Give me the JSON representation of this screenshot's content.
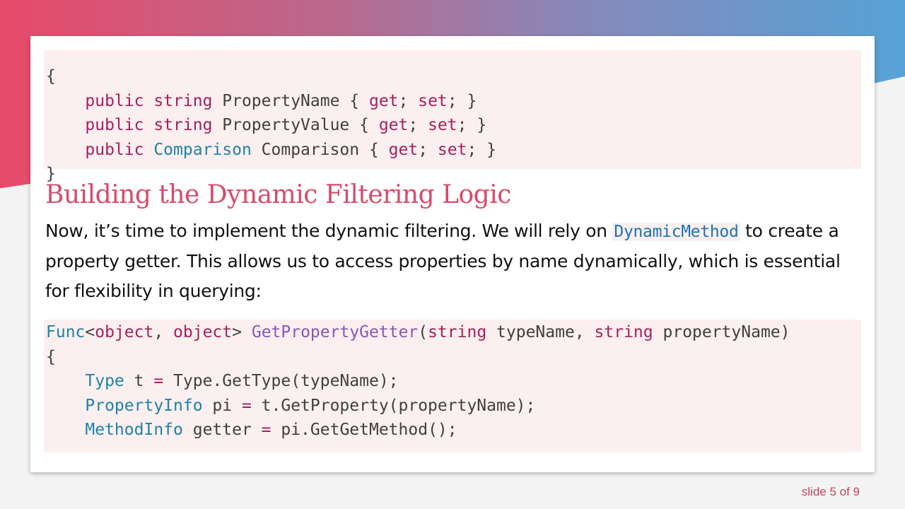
{
  "colors": {
    "accent": "#d9496c",
    "keyword": "#a3215e",
    "type": "#1d84a8",
    "function": "#8757b8",
    "code_bg": "#fcefef"
  },
  "code_block_1": {
    "lines": [
      [
        {
          "t": "{",
          "c": "p"
        }
      ],
      [
        {
          "t": "    public ",
          "c": "kw"
        },
        {
          "t": "string ",
          "c": "kw"
        },
        {
          "t": "PropertyName { ",
          "c": "p"
        },
        {
          "t": "get",
          "c": "kw"
        },
        {
          "t": "; ",
          "c": "p"
        },
        {
          "t": "set",
          "c": "kw"
        },
        {
          "t": "; }",
          "c": "p"
        }
      ],
      [
        {
          "t": "    public ",
          "c": "kw"
        },
        {
          "t": "string ",
          "c": "kw"
        },
        {
          "t": "PropertyValue { ",
          "c": "p"
        },
        {
          "t": "get",
          "c": "kw"
        },
        {
          "t": "; ",
          "c": "p"
        },
        {
          "t": "set",
          "c": "kw"
        },
        {
          "t": "; }",
          "c": "p"
        }
      ],
      [
        {
          "t": "    public ",
          "c": "kw"
        },
        {
          "t": "Comparison ",
          "c": "type"
        },
        {
          "t": "Comparison { ",
          "c": "p"
        },
        {
          "t": "get",
          "c": "kw"
        },
        {
          "t": "; ",
          "c": "p"
        },
        {
          "t": "set",
          "c": "kw"
        },
        {
          "t": "; }",
          "c": "p"
        }
      ],
      [
        {
          "t": "}",
          "c": "p"
        }
      ]
    ]
  },
  "heading": "Building the Dynamic Filtering Logic",
  "paragraph": {
    "before": "Now, it’s time to implement the dynamic filtering. We will rely on ",
    "inline_code": "DynamicMethod",
    "after": " to create a property getter. This allows us to access properties by name dynamically, which is essential for flexibility in querying:"
  },
  "code_block_2": {
    "lines": [
      [
        {
          "t": "Func",
          "c": "type"
        },
        {
          "t": "<",
          "c": "p"
        },
        {
          "t": "object",
          "c": "kw"
        },
        {
          "t": ", ",
          "c": "p"
        },
        {
          "t": "object",
          "c": "kw"
        },
        {
          "t": "> ",
          "c": "p"
        },
        {
          "t": "GetPropertyGetter",
          "c": "fn"
        },
        {
          "t": "(",
          "c": "p"
        },
        {
          "t": "string ",
          "c": "kw"
        },
        {
          "t": "typeName, ",
          "c": "p"
        },
        {
          "t": "string ",
          "c": "kw"
        },
        {
          "t": "propertyName)",
          "c": "p"
        }
      ],
      [
        {
          "t": "{",
          "c": "p"
        }
      ],
      [
        {
          "t": "    Type ",
          "c": "type"
        },
        {
          "t": "t ",
          "c": "p"
        },
        {
          "t": "= ",
          "c": "kw"
        },
        {
          "t": "Type.GetType(typeName);",
          "c": "p"
        }
      ],
      [
        {
          "t": "    PropertyInfo ",
          "c": "type"
        },
        {
          "t": "pi ",
          "c": "p"
        },
        {
          "t": "= ",
          "c": "kw"
        },
        {
          "t": "t.GetProperty(propertyName);",
          "c": "p"
        }
      ],
      [
        {
          "t": "    MethodInfo ",
          "c": "type"
        },
        {
          "t": "getter ",
          "c": "p"
        },
        {
          "t": "= ",
          "c": "kw"
        },
        {
          "t": "pi.GetGetMethod();",
          "c": "p"
        }
      ]
    ]
  },
  "slide_counter": "slide 5 of 9"
}
